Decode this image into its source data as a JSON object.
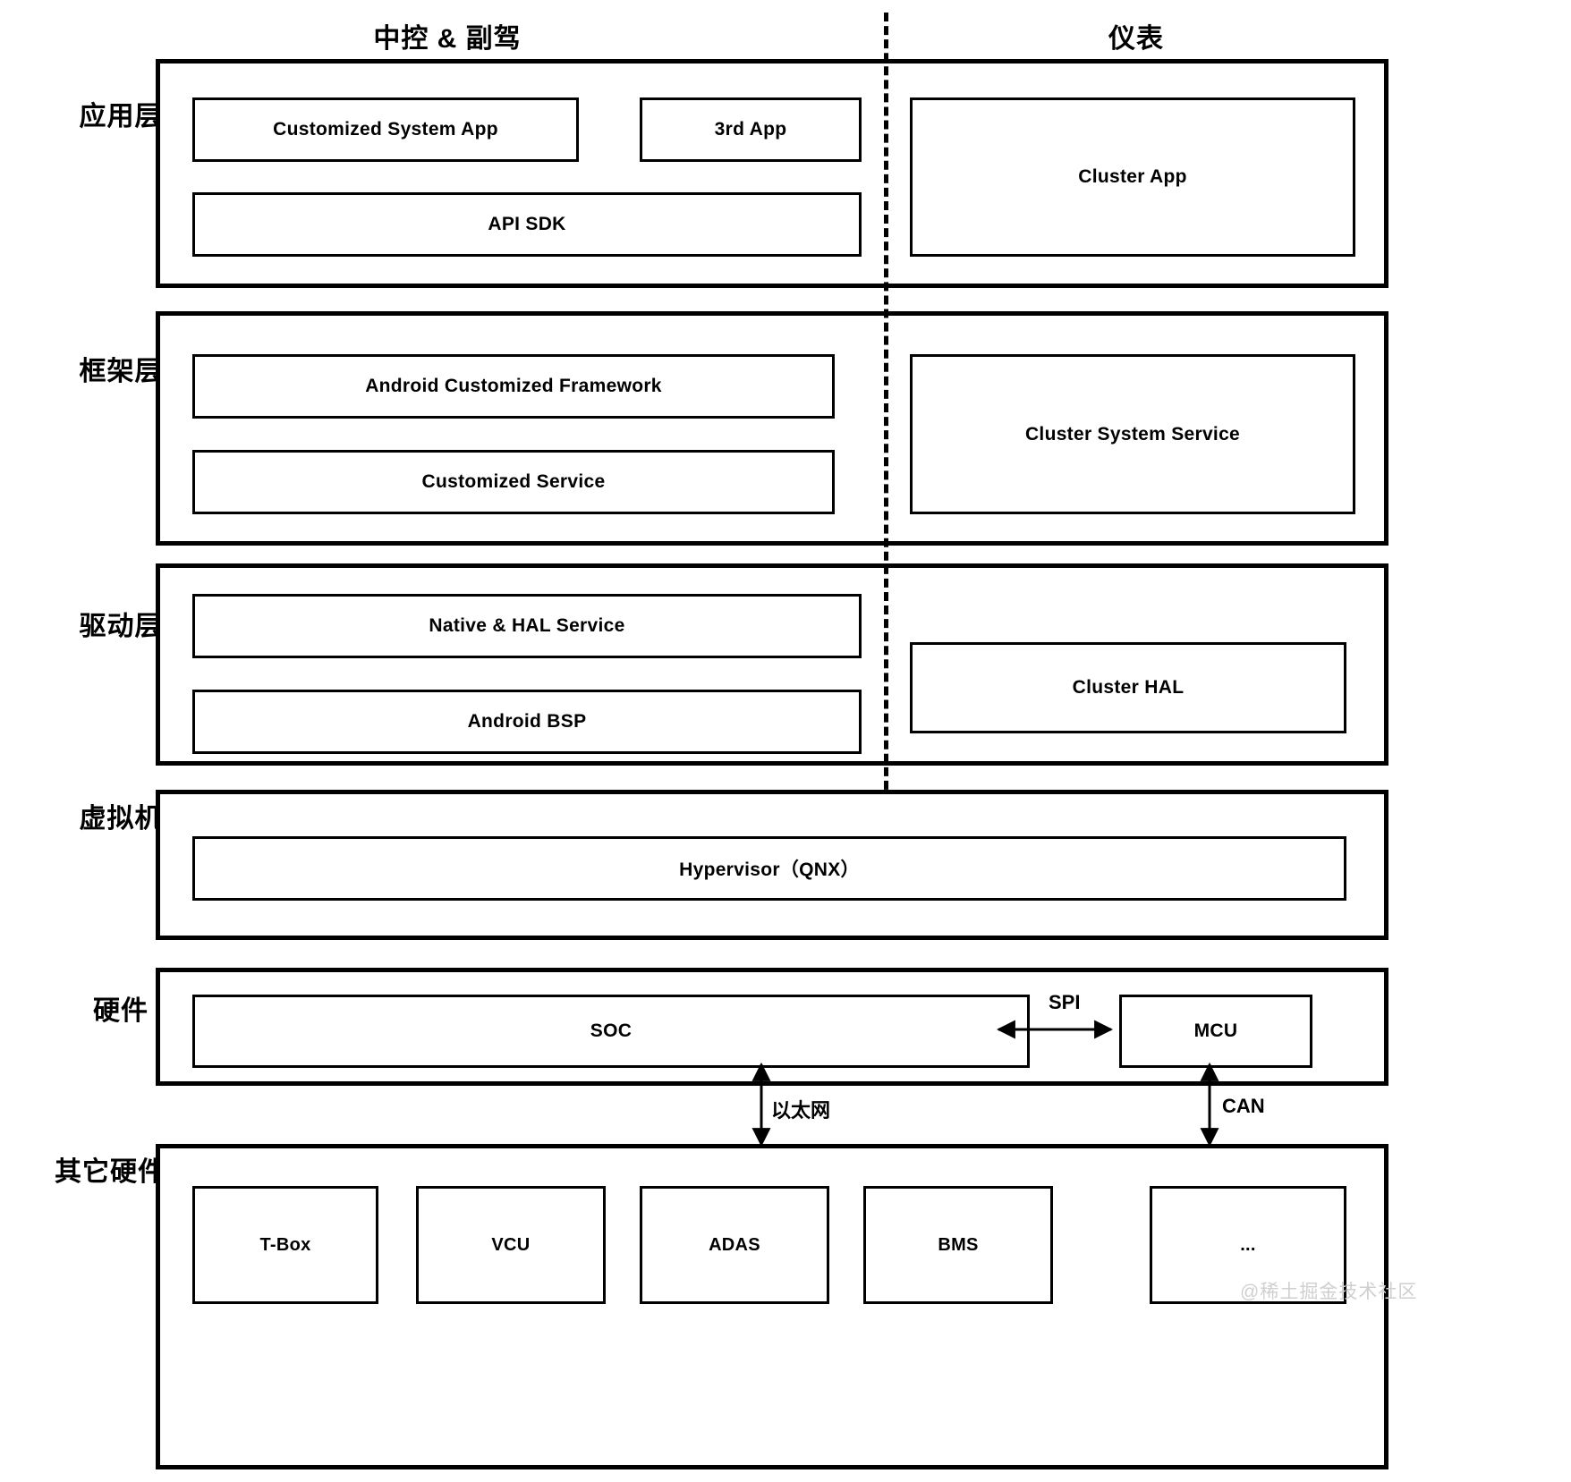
{
  "diagram": {
    "title_columns": [
      {
        "label": "中控 & 副驾"
      },
      {
        "label": "仪表"
      }
    ],
    "row_labels": [
      {
        "label": "应用层"
      },
      {
        "label": "框架层"
      },
      {
        "label": "驱动层"
      },
      {
        "label": "虚拟机"
      },
      {
        "label": "硬件"
      },
      {
        "label": "其它硬件"
      }
    ],
    "layers": {
      "application": {
        "label": "应用层",
        "left_blocks": [
          {
            "label": "Customized System App"
          },
          {
            "label": "3rd App"
          },
          {
            "label": "API SDK"
          }
        ],
        "right_blocks": [
          {
            "label": "Cluster App"
          }
        ]
      },
      "framework": {
        "label": "框架层",
        "left_blocks": [
          {
            "label": "Android Customized Framework"
          },
          {
            "label": "Customized Service"
          }
        ],
        "right_blocks": [
          {
            "label": "Cluster System Service"
          }
        ]
      },
      "driver": {
        "label": "驱动层",
        "left_blocks": [
          {
            "label": "Native & HAL Service"
          },
          {
            "label": "Android BSP"
          }
        ],
        "right_blocks": [
          {
            "label": "Cluster HAL"
          }
        ]
      },
      "virtual_machine": {
        "label": "虚拟机",
        "blocks": [
          {
            "label": "Hypervisor（QNX）"
          }
        ]
      },
      "hardware": {
        "label": "硬件",
        "blocks": [
          {
            "label": "SOC"
          },
          {
            "label": "MCU"
          }
        ]
      },
      "other_hardware": {
        "label": "其它硬件",
        "blocks": [
          {
            "label": "T-Box"
          },
          {
            "label": "VCU"
          },
          {
            "label": "ADAS"
          },
          {
            "label": "BMS"
          },
          {
            "label": "..."
          }
        ]
      }
    },
    "connections": [
      {
        "label": "SPI",
        "from": "SOC",
        "to": "MCU",
        "direction": "bidirectional"
      },
      {
        "label": "以太网",
        "from": "SOC",
        "to": "其它硬件",
        "direction": "bidirectional"
      },
      {
        "label": "CAN",
        "from": "MCU",
        "to": "其它硬件",
        "direction": "bidirectional"
      }
    ],
    "watermark": "@稀土掘金技术社区",
    "colors": {
      "stroke": "#000000",
      "background": "#ffffff",
      "watermark": "#cfcfcf"
    }
  }
}
